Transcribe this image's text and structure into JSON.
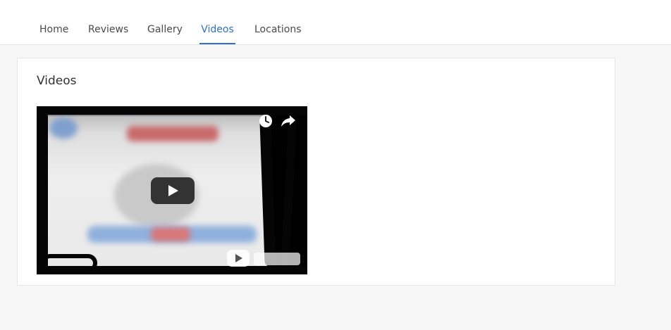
{
  "nav": {
    "items": [
      {
        "label": "Home",
        "active": false
      },
      {
        "label": "Reviews",
        "active": false
      },
      {
        "label": "Gallery",
        "active": false
      },
      {
        "label": "Videos",
        "active": true
      },
      {
        "label": "Locations",
        "active": false
      }
    ]
  },
  "section": {
    "title": "Videos"
  },
  "video": {
    "icons": [
      "watch-later-icon",
      "share-icon",
      "play-icon",
      "youtube-logo-icon"
    ]
  },
  "colors": {
    "accent": "#2f6fd0",
    "background": "#f7f7f7",
    "card": "#ffffff",
    "text": "#333333"
  }
}
